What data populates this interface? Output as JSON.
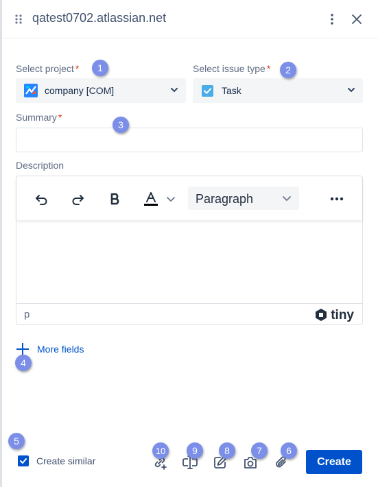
{
  "header": {
    "title": "qatest0702.atlassian.net",
    "drag_icon": "drag-handle-icon",
    "menu_icon": "more-vertical-icon",
    "close_icon": "close-icon"
  },
  "form": {
    "project": {
      "label": "Select project",
      "required_mark": "*",
      "value": "company [COM]",
      "icon": "project-avatar-icon"
    },
    "issue_type": {
      "label": "Select issue type",
      "required_mark": "*",
      "value": "Task",
      "icon": "task-checkbox-icon"
    },
    "summary": {
      "label": "Summary",
      "required_mark": "*",
      "value": ""
    },
    "description": {
      "label": "Description",
      "toolbar": {
        "undo_icon": "undo-icon",
        "redo_icon": "redo-icon",
        "bold_icon": "bold-icon",
        "text_color_icon": "text-color-icon",
        "block_format": "Paragraph",
        "more_icon": "more-horizontal-icon"
      },
      "statusbar": {
        "path": "p",
        "brand": "tiny"
      }
    },
    "more_fields": {
      "label": "More fields"
    }
  },
  "footer": {
    "create_similar": {
      "label": "Create similar",
      "checked": true
    },
    "action_icons": [
      "link-add-icon",
      "text-cursor-icon",
      "edit-icon",
      "camera-icon",
      "paperclip-icon"
    ],
    "create_label": "Create"
  },
  "badges": [
    "1",
    "2",
    "3",
    "4",
    "5",
    "6",
    "7",
    "8",
    "9",
    "10"
  ],
  "colors": {
    "primary": "#0052cc",
    "required": "#de350b",
    "badge": "#7b8ee8",
    "task": "#4bade8"
  }
}
